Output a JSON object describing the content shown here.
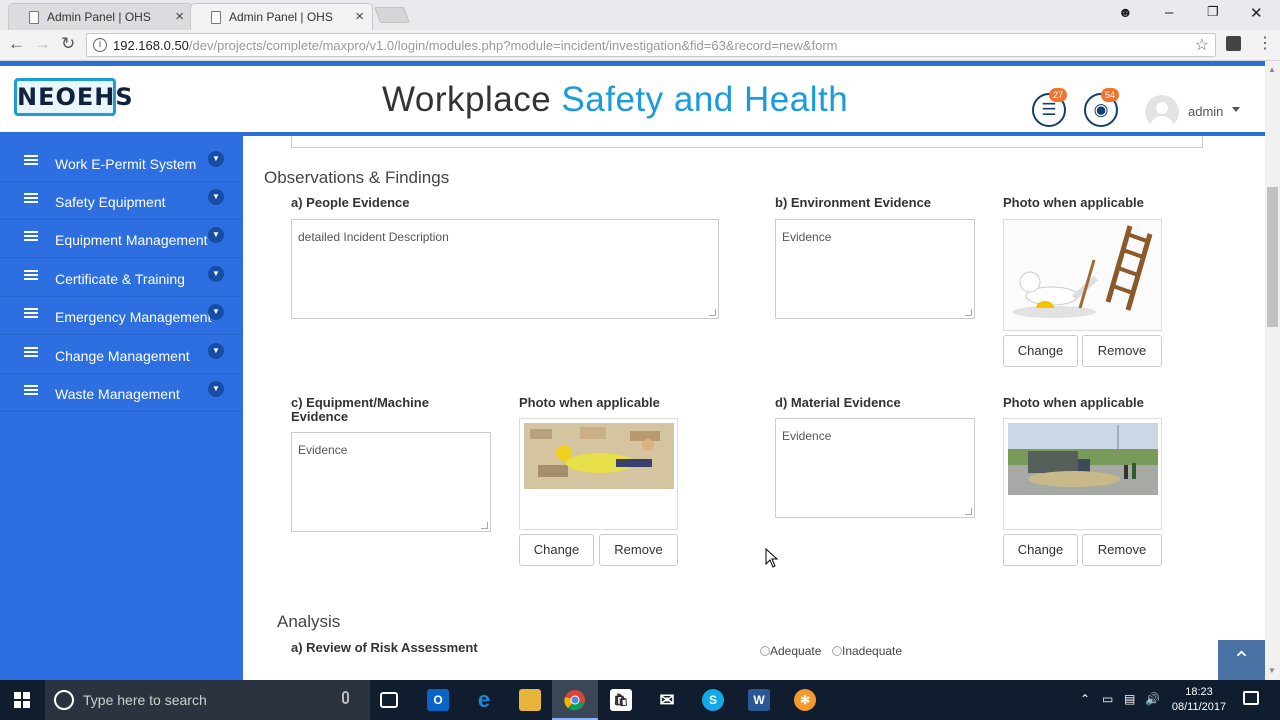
{
  "browser": {
    "tabs": [
      {
        "label": "Admin Panel | OHS"
      },
      {
        "label": "Admin Panel | OHS"
      }
    ],
    "url_host": "192.168.0.50",
    "url_path": "/dev/projects/complete/maxpro/v1.0/login/modules.php?module=incident/investigation&fid=63&record=new&form"
  },
  "header": {
    "logo": "NEOEHS",
    "title_part1": "Workplace ",
    "title_part2": "Safety and Health",
    "badge_tasks": "27",
    "badge_globe": "54",
    "username": "admin"
  },
  "sidebar": {
    "items": [
      {
        "label": "Work E-Permit System"
      },
      {
        "label": "Safety Equipment"
      },
      {
        "label": "Equipment Management"
      },
      {
        "label": "Certificate & Training"
      },
      {
        "label": "Emergency Management"
      },
      {
        "label": "Change Management"
      },
      {
        "label": "Waste Management"
      }
    ]
  },
  "observations": {
    "title": "Observations & Findings",
    "people_label": "a) People Evidence",
    "people_value": "detailed Incident Description",
    "env_label": "b) Environment Evidence",
    "env_value": "Evidence",
    "photo_label": "Photo when applicable",
    "equip_label": "c) Equipment/Machine Evidence",
    "equip_value": "Evidence",
    "material_label": "d) Material Evidence",
    "material_value": "Evidence",
    "change_btn": "Change",
    "remove_btn": "Remove"
  },
  "analysis": {
    "title": "Analysis",
    "risk_label": "a) Review of Risk Assessment",
    "opt_adequate": "Adequate",
    "opt_inadequate": "Inadequate"
  },
  "taskbar": {
    "search_placeholder": "Type here to search",
    "time": "18:23",
    "date": "08/11/2017"
  },
  "colors": {
    "sidebar": "#2d6ee0",
    "accent": "#1a9be0",
    "badge": "#f0742b",
    "taskbar": "#101d2e"
  }
}
